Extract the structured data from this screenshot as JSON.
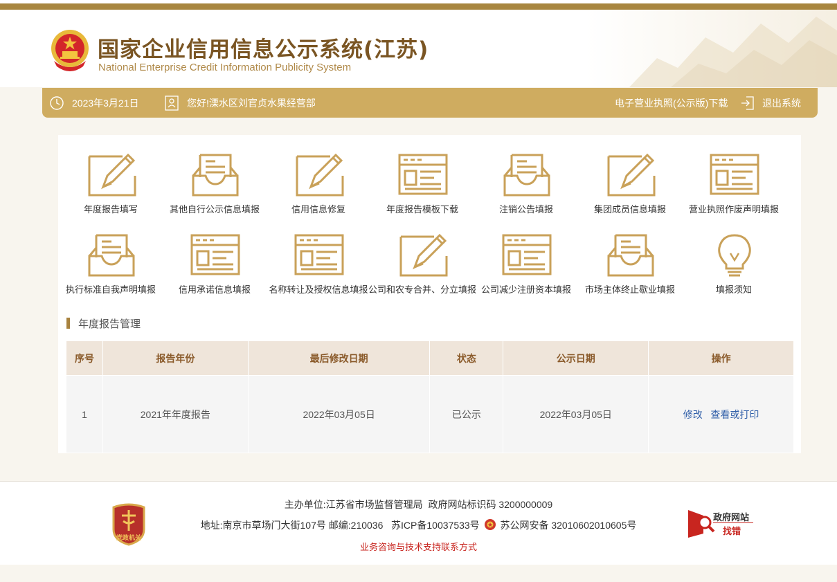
{
  "header": {
    "title": "国家企业信用信息公示系统(江苏)",
    "subtitle": "National Enterprise Credit Information Publicity System"
  },
  "userbar": {
    "date": "2023年3月21日",
    "greeting": "您好!溧水区刘官贞水果经营部",
    "license_download": "电子营业执照(公示版)下载",
    "logout": "退出系统"
  },
  "tiles": [
    {
      "label": "年度报告填写",
      "icon": "edit-icon"
    },
    {
      "label": "其他自行公示信息填报",
      "icon": "inbox-icon"
    },
    {
      "label": "信用信息修复",
      "icon": "edit-icon"
    },
    {
      "label": "年度报告模板下载",
      "icon": "template-icon"
    },
    {
      "label": "注销公告填报",
      "icon": "inbox-icon"
    },
    {
      "label": "集团成员信息填报",
      "icon": "edit-icon"
    },
    {
      "label": "营业执照作废声明填报",
      "icon": "template-icon"
    },
    {
      "label": "执行标准自我声明填报",
      "icon": "inbox-icon"
    },
    {
      "label": "信用承诺信息填报",
      "icon": "template-icon"
    },
    {
      "label": "名称转让及授权信息填报",
      "icon": "template-icon"
    },
    {
      "label": "公司和农专合并、分立填报",
      "icon": "edit-icon"
    },
    {
      "label": "公司减少注册资本填报",
      "icon": "template-icon"
    },
    {
      "label": "市场主体终止歇业填报",
      "icon": "inbox-icon"
    },
    {
      "label": "填报须知",
      "icon": "lightbulb-icon"
    }
  ],
  "section": {
    "title": "年度报告管理"
  },
  "table": {
    "columns": [
      "序号",
      "报告年份",
      "最后修改日期",
      "状态",
      "公示日期",
      "操作"
    ],
    "rows": [
      {
        "no": "1",
        "year": "2021年年度报告",
        "modified": "2022年03月05日",
        "status": "已公示",
        "published": "2022年03月05日",
        "actions": [
          "修改",
          "查看或打印"
        ]
      }
    ]
  },
  "footer": {
    "host_prefix": "主办单位:",
    "host": "江苏省市场监督管理局",
    "site_code": "政府网站标识码  3200000009",
    "address": "地址:南京市草场门大街107号  邮编:210036",
    "icp": "苏ICP备10037533号",
    "police": "苏公网安备 32010602010605号",
    "contact": "业务咨询与技术支持联系方式",
    "party_badge": "党政机关",
    "error_badge_line1": "政府网站",
    "error_badge_line2": "找错"
  },
  "colors": {
    "gold": "#cfac60",
    "dark_gold": "#a8863f",
    "brown": "#7a5523",
    "link": "#2f5ea8",
    "contact_red": "#c8251f"
  }
}
